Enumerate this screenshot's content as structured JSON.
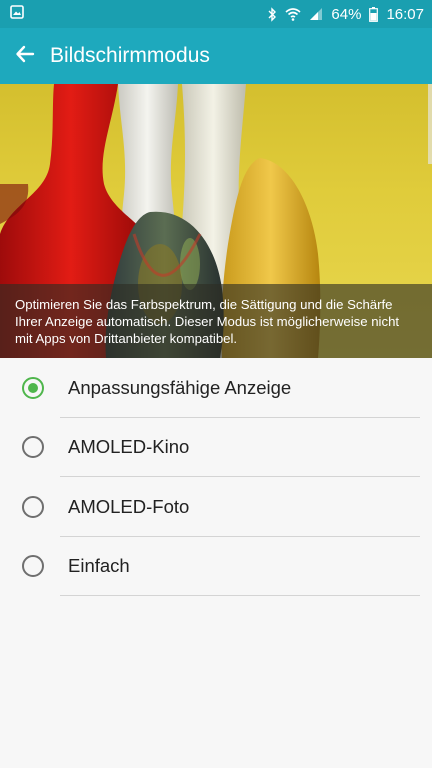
{
  "status_bar": {
    "battery_percent": "64%",
    "time": "16:07",
    "icons": [
      "gallery-notification-icon",
      "bluetooth-icon",
      "wifi-icon",
      "signal-icon",
      "battery-icon"
    ]
  },
  "app_bar": {
    "title": "Bildschirmmodus",
    "back_icon": "back-arrow-icon"
  },
  "hero": {
    "description": "Optimieren Sie das Farbspektrum, die Sättigung und die Schärfe Ihrer Anzeige automatisch. Dieser Modus ist möglicherweise nicht mit Apps von Drittanbieter kompatibel."
  },
  "options": [
    {
      "label": "Anpassungsfähige Anzeige",
      "selected": true
    },
    {
      "label": "AMOLED-Kino",
      "selected": false
    },
    {
      "label": "AMOLED-Foto",
      "selected": false
    },
    {
      "label": "Einfach",
      "selected": false
    }
  ],
  "colors": {
    "status_bar": "#1a9fb0",
    "app_bar": "#1ea9bd",
    "accent_green": "#4fb64c",
    "background": "#f7f7f7"
  }
}
